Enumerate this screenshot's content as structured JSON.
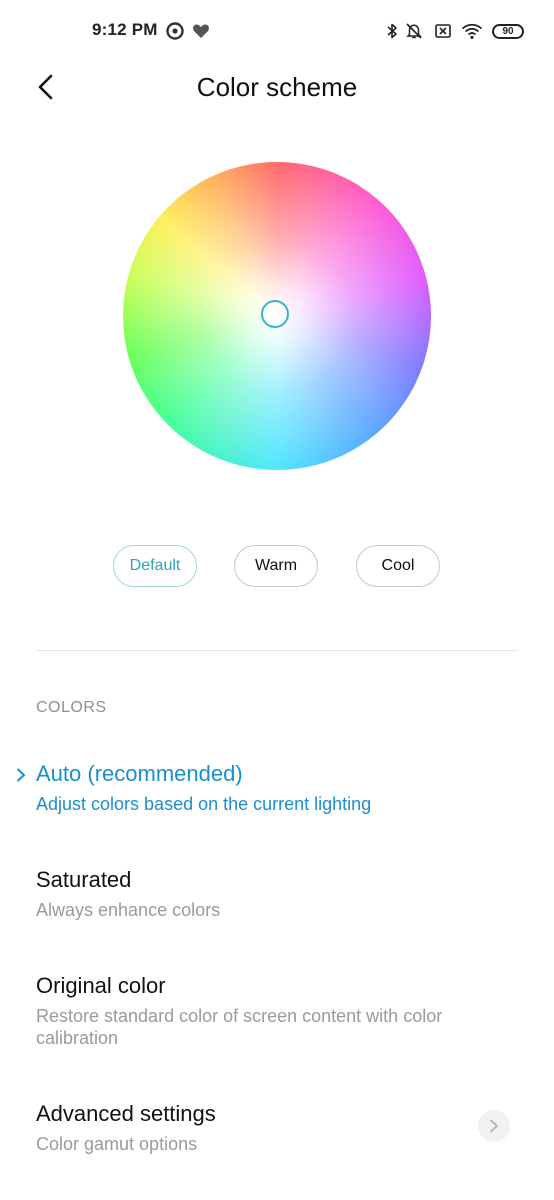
{
  "status_bar": {
    "time": "9:12 PM",
    "battery": "90",
    "icons": [
      "play-circle-icon",
      "heart-icon",
      "bluetooth-icon",
      "mute-bell-icon",
      "sim-off-icon",
      "wifi-icon",
      "battery-icon"
    ]
  },
  "header": {
    "title": "Color scheme",
    "back_icon": "chevron-left-icon"
  },
  "color_wheel": {
    "selector_color": "#36b6c8"
  },
  "presets": [
    {
      "label": "Default",
      "active": true
    },
    {
      "label": "Warm",
      "active": false
    },
    {
      "label": "Cool",
      "active": false
    }
  ],
  "colors_section": {
    "header": "COLORS",
    "options": [
      {
        "title": "Auto (recommended)",
        "subtitle": "Adjust colors based on the current lighting",
        "selected": true
      },
      {
        "title": "Saturated",
        "subtitle": "Always enhance colors",
        "selected": false
      },
      {
        "title": "Original color",
        "subtitle": "Restore standard color of screen content with color calibration",
        "selected": false
      },
      {
        "title": "Advanced settings",
        "subtitle": "Color gamut options",
        "selected": false
      }
    ]
  },
  "theme": {
    "accent": "#1a8fcf",
    "preset_active": "#2aa6b8",
    "subtitle_gray": "#9a9a9a"
  }
}
